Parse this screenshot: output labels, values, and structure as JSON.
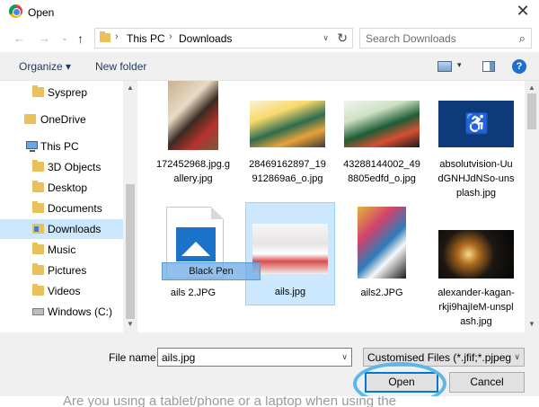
{
  "window": {
    "title": "Open",
    "close_label": "✕"
  },
  "nav_buttons": {
    "back": "←",
    "forward": "→",
    "recent": "⌄",
    "up": "↑"
  },
  "address": {
    "crumbs": [
      "This PC",
      "Downloads"
    ],
    "separator": "›",
    "dropdown": "∨",
    "refresh": "↻"
  },
  "search": {
    "placeholder": "Search Downloads",
    "icon": "⌕"
  },
  "toolbar": {
    "organize_label": "Organize ▾",
    "new_folder_label": "New folder",
    "view_dropdown": "▾",
    "help_label": "?"
  },
  "sidebar": {
    "items": [
      {
        "label": "Sysprep",
        "icon": "folder-icon"
      },
      {
        "label": "OneDrive",
        "icon": "onedrive-icon"
      },
      {
        "label": "This PC",
        "icon": "computer-icon"
      },
      {
        "label": "3D Objects",
        "icon": "folder-3d-icon"
      },
      {
        "label": "Desktop",
        "icon": "desktop-folder-icon"
      },
      {
        "label": "Documents",
        "icon": "documents-folder-icon"
      },
      {
        "label": "Downloads",
        "icon": "downloads-folder-icon",
        "selected": true
      },
      {
        "label": "Music",
        "icon": "music-folder-icon"
      },
      {
        "label": "Pictures",
        "icon": "pictures-folder-icon"
      },
      {
        "label": "Videos",
        "icon": "videos-folder-icon"
      },
      {
        "label": "Windows (C:)",
        "icon": "drive-icon"
      }
    ],
    "scroll_up": "▲",
    "scroll_down": "▼"
  },
  "files": [
    {
      "name": "172452968.jpg.gallery.jpg",
      "lines": [
        "172452968.jpg.g",
        "allery.jpg"
      ]
    },
    {
      "name": "28469162897_19912869a6_o.jpg",
      "lines": [
        "28469162897_19",
        "912869a6_o.jpg"
      ]
    },
    {
      "name": "43288144002_498805edfd_o.jpg",
      "lines": [
        "43288144002_49",
        "8805edfd_o.jpg"
      ]
    },
    {
      "name": "absolutvision-UudGNHJdNSo-unsplash.jpg",
      "lines": [
        "absolutvision-Uu",
        "dGNHJdNSo-uns",
        "plash.jpg"
      ]
    },
    {
      "name": "ails 2.JPG",
      "lines": [
        "ails 2.JPG"
      ]
    },
    {
      "name": "ails.jpg",
      "lines": [
        "ails.jpg"
      ],
      "selected": true
    },
    {
      "name": "ails2.JPG",
      "lines": [
        "ails2.JPG"
      ]
    },
    {
      "name": "alexander-kagan-rkji9hajleM-unsplash.jpg",
      "lines": [
        "alexander-kagan-",
        "rkji9hajIeM-unspl",
        "ash.jpg"
      ]
    }
  ],
  "accessibility_glyph": "♿",
  "drag_ghost_label": "Black Pen",
  "files_scroll": {
    "up": "▲",
    "down": "▼"
  },
  "bottom": {
    "file_name_label": "File name:",
    "file_name_value": "ails.jpg",
    "file_type_value": "Customised Files (*.jfif;*.pjpeg;*",
    "dropdown": "∨",
    "open_label": "Open",
    "cancel_label": "Cancel"
  },
  "background_text": "Are you using a tablet/phone or a laptop when using the"
}
